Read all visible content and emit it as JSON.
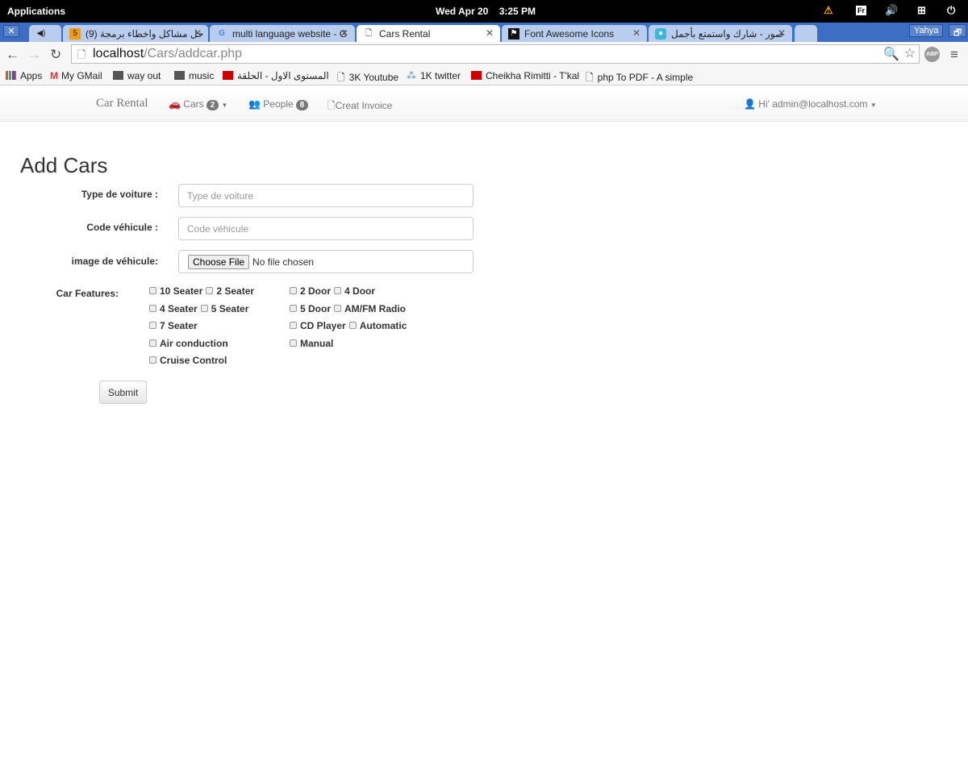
{
  "os": {
    "apps": "Applications",
    "date": "Wed Apr 20",
    "time": "3:25 PM",
    "kb": "Fr"
  },
  "browser": {
    "tabs": [
      {
        "label": "",
        "icon": "speaker-icon"
      },
      {
        "label": "(9) حل مشاكل واخطاء برمجة",
        "icon": "html5-icon"
      },
      {
        "label": "multi language website - G",
        "icon": "google-icon"
      },
      {
        "label": "Cars Rental",
        "icon": "page-icon"
      },
      {
        "label": "Font Awesome Icons",
        "icon": "flag-icon"
      },
      {
        "label": "صور - شارك واستمتع بأجمل",
        "icon": "app-icon"
      }
    ],
    "user": "Yahya",
    "url_host": "localhost",
    "url_path": "/Cars/addcar.php",
    "bookmarks": [
      "Apps",
      "My GMail",
      "way out",
      "music",
      "المستوى الاول - الحلقة",
      "3K Youtube",
      "1K twitter",
      "Cheikha Rimitti - T'kal",
      "php To PDF - A simple"
    ]
  },
  "navbar": {
    "brand": "Car Rental",
    "cars": "Cars",
    "cars_count": "2",
    "people": "People",
    "people_count": "8",
    "invoice": "Creat Invoice",
    "user": "Hi' admin@localhost.com"
  },
  "form": {
    "title": "Add Cars",
    "type_label": "Type de voiture :",
    "type_placeholder": "Type de voiture",
    "code_label": "Code véhicule :",
    "code_placeholder": "Code véhicule",
    "image_label": "image de véhicule:",
    "file_button": "Choose File",
    "file_status": "No file chosen",
    "features_label": "Car Features:",
    "features_col1": [
      [
        "10 Seater",
        "2 Seater"
      ],
      [
        "4 Seater",
        "5 Seater"
      ],
      [
        "7 Seater"
      ],
      [
        "Air conduction"
      ],
      [
        "Cruise Control"
      ]
    ],
    "features_col2": [
      [
        "2 Door",
        "4 Door"
      ],
      [
        "5 Door",
        "AM/FM Radio"
      ],
      [
        "CD Player",
        "Automatic"
      ],
      [
        "Manual"
      ]
    ],
    "submit": "Submit"
  }
}
